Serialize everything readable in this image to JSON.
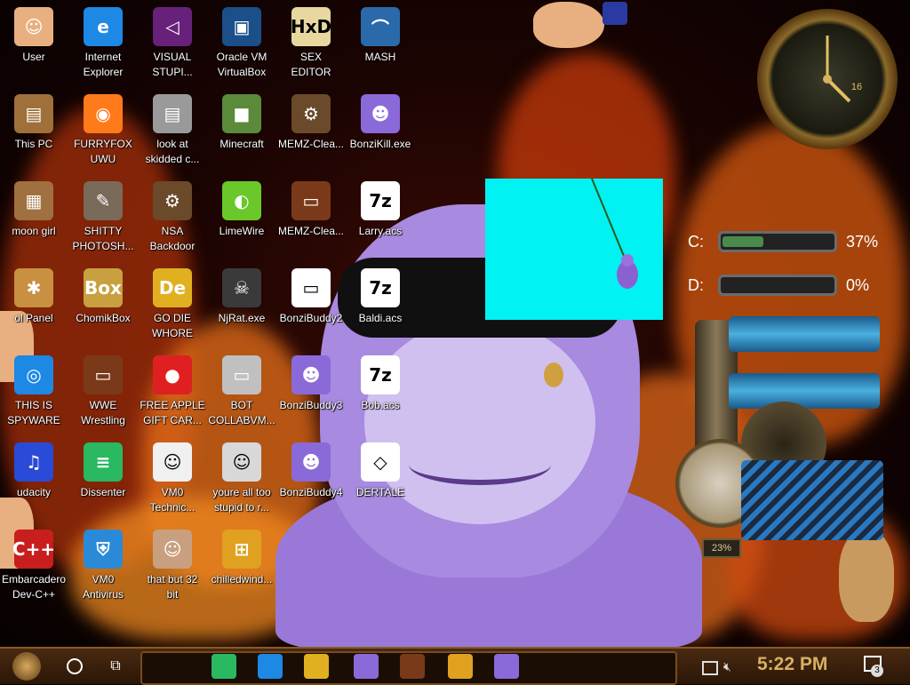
{
  "desktop_icons": [
    {
      "label": "User",
      "icon": "user-face-icon",
      "color": "#e8b080"
    },
    {
      "label": "Internet\nExplorer",
      "icon": "edge-browser-icon",
      "color": "#1e88e5"
    },
    {
      "label": "VISUAL\nSTUPI...",
      "icon": "visual-studio-icon",
      "color": "#68217a"
    },
    {
      "label": "Oracle VM\nVirtualBox",
      "icon": "virtualbox-icon",
      "color": "#1a4f8a"
    },
    {
      "label": "SEX\nEDITOR",
      "icon": "hex-editor-icon",
      "color": "#e8d8a0"
    },
    {
      "label": "MASH",
      "icon": "mash-icon",
      "color": "#2a6aaa"
    },
    {
      "label": "This PC",
      "icon": "computer-icon",
      "color": "#a0703a"
    },
    {
      "label": "FURRYFOX\nUWU",
      "icon": "firefox-icon",
      "color": "#ff7a1a"
    },
    {
      "label": "look at\nskidded c...",
      "icon": "files-icon",
      "color": "#9a9a9a"
    },
    {
      "label": "Minecraft",
      "icon": "minecraft-icon",
      "color": "#5a8a3a"
    },
    {
      "label": "MEMZ-Clea...",
      "icon": "steampunk-gear-icon",
      "color": "#6a4a2a"
    },
    {
      "label": "BonziKill.exe",
      "icon": "bonzi-icon",
      "color": "#8a6ad8"
    },
    {
      "label": "moon girl",
      "icon": "folder-icon",
      "color": "#a07040"
    },
    {
      "label": "SHITTY\nPHOTOSH...",
      "icon": "gimp-icon",
      "color": "#7a6a5a"
    },
    {
      "label": "NSA\nBackdoor",
      "icon": "steampunk-gear-icon",
      "color": "#6a4a2a"
    },
    {
      "label": "LimeWire",
      "icon": "limewire-icon",
      "color": "#6ac82a"
    },
    {
      "label": "MEMZ-Clea...",
      "icon": "steampunk-window-icon",
      "color": "#7a3a1a"
    },
    {
      "label": "Larry.acs",
      "icon": "7zip-icon",
      "color": "#ffffff"
    },
    {
      "label": "ol Panel",
      "icon": "lightbulb-icon",
      "color": "#c89040"
    },
    {
      "label": "ChomikBox",
      "icon": "chomikbox-icon",
      "color": "#c8a040"
    },
    {
      "label": "GO DIE\nWHORE",
      "icon": "de-logo-icon",
      "color": "#e0b020"
    },
    {
      "label": "NjRat.exe",
      "icon": "skull-icon",
      "color": "#3a3a3a"
    },
    {
      "label": "BonziBuddy2",
      "icon": "window-icon",
      "color": "#ffffff"
    },
    {
      "label": "Baldi.acs",
      "icon": "7zip-icon",
      "color": "#ffffff"
    },
    {
      "label": "THIS IS\nSPYWARE",
      "icon": "chrome-icon",
      "color": "#1e88e5"
    },
    {
      "label": "WWE\nWrestling",
      "icon": "steampunk-window-icon",
      "color": "#7a3a1a"
    },
    {
      "label": "FREE APPLE\nGIFT CAR...",
      "icon": "apple-icon",
      "color": "#e02020"
    },
    {
      "label": "BOT\nCOLLABVM...",
      "icon": "monitor-icon",
      "color": "#c0c0c0"
    },
    {
      "label": "BonziBuddy3",
      "icon": "bonzi-icon",
      "color": "#8a6ad8"
    },
    {
      "label": "Bob.acs",
      "icon": "7zip-icon",
      "color": "#ffffff"
    },
    {
      "label": "udacity",
      "icon": "audacity-icon",
      "color": "#2a4ad8"
    },
    {
      "label": "Dissenter",
      "icon": "dissenter-icon",
      "color": "#2ab860"
    },
    {
      "label": "VM0\nTechnic...",
      "icon": "technician-icon",
      "color": "#f0f0f0"
    },
    {
      "label": "youre all too\nstupid to r...",
      "icon": "portrait-icon",
      "color": "#d8d8d8"
    },
    {
      "label": "BonziBuddy4",
      "icon": "bonzi-icon",
      "color": "#8a6ad8"
    },
    {
      "label": "DERTALE",
      "icon": "unity-icon",
      "color": "#ffffff"
    },
    {
      "label": "Embarcadero\nDev-C++",
      "icon": "devcpp-icon",
      "color": "#c81e1e"
    },
    {
      "label": "VM0\nAntivirus",
      "icon": "shield-icon",
      "color": "#2a8ad8"
    },
    {
      "label": "that but 32\nbit",
      "icon": "portrait-icon",
      "color": "#c8a080"
    },
    {
      "label": "chilledwind...",
      "icon": "windows-flag-icon",
      "color": "#e0a020"
    }
  ],
  "icon_glyphs": {
    "edge-browser-icon": "e",
    "visual-studio-icon": "◁",
    "virtualbox-icon": "▣",
    "hex-editor-icon": "HxD",
    "mash-icon": "⌒",
    "computer-icon": "▤",
    "firefox-icon": "◉",
    "files-icon": "▤",
    "minecraft-icon": "■",
    "steampunk-gear-icon": "⚙",
    "bonzi-icon": "☻",
    "folder-icon": "▦",
    "gimp-icon": "✎",
    "limewire-icon": "◐",
    "steampunk-window-icon": "▭",
    "7zip-icon": "7z",
    "lightbulb-icon": "✱",
    "chomikbox-icon": "Box",
    "de-logo-icon": "De",
    "skull-icon": "☠",
    "window-icon": "▭",
    "chrome-icon": "◎",
    "apple-icon": "●",
    "monitor-icon": "▭",
    "audacity-icon": "♫",
    "dissenter-icon": "≡",
    "technician-icon": "☺",
    "portrait-icon": "☺",
    "unity-icon": "◇",
    "devcpp-icon": "C++",
    "shield-icon": "⛨",
    "windows-flag-icon": "⊞",
    "user-face-icon": "☺"
  },
  "disks": [
    {
      "letter": "C:",
      "percent": "37%",
      "fill": 0.37
    },
    {
      "letter": "D:",
      "percent": "0%",
      "fill": 0.0
    }
  ],
  "clock_widget": {
    "date": "16"
  },
  "gauge_widget": {
    "percent": "23%"
  },
  "taskbar": {
    "time": "5:22 PM",
    "notification_count": "3",
    "apps": [
      {
        "name": "dissenter-task-icon",
        "color": "#2ab860"
      },
      {
        "name": "chrome-task-icon",
        "color": "#1e88e5"
      },
      {
        "name": "file-explorer-task-icon",
        "color": "#e0b020"
      },
      {
        "name": "bonzi-task-icon",
        "color": "#8a6ad8"
      },
      {
        "name": "steampunk-window-task-icon",
        "color": "#7a3a1a"
      },
      {
        "name": "windows-flag-task-icon",
        "color": "#e0a020"
      },
      {
        "name": "bonzi-task-icon-2",
        "color": "#8a6ad8"
      }
    ]
  },
  "colors": {
    "cyan_window": "#00f2f2",
    "accent_gold": "#d8b060"
  }
}
